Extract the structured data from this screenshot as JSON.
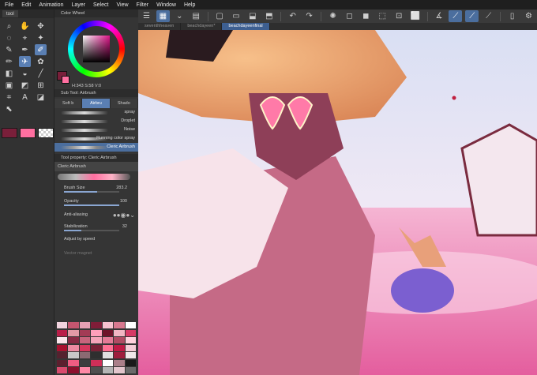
{
  "menu": [
    "File",
    "Edit",
    "Animation",
    "Layer",
    "Select",
    "View",
    "Filter",
    "Window",
    "Help"
  ],
  "tool_panel": {
    "tab_label": "tool"
  },
  "tools": [
    {
      "icon": "magnifier-icon",
      "glyph": "⌕"
    },
    {
      "icon": "hand-icon",
      "glyph": "✋"
    },
    {
      "icon": "move-icon",
      "glyph": "✥"
    },
    {
      "icon": "lasso-icon",
      "glyph": "◌"
    },
    {
      "icon": "select-icon",
      "glyph": "⌖"
    },
    {
      "icon": "wand-icon",
      "glyph": "✦"
    },
    {
      "icon": "eyedropper-icon",
      "glyph": "✎"
    },
    {
      "icon": "pen-icon",
      "glyph": "✒"
    },
    {
      "icon": "brush-icon",
      "glyph": "✐",
      "active": true
    },
    {
      "icon": "pencil-icon",
      "glyph": "✏"
    },
    {
      "icon": "airbrush-icon",
      "glyph": "✈",
      "active": true
    },
    {
      "icon": "decoration-icon",
      "glyph": "✿"
    },
    {
      "icon": "eraser-icon",
      "glyph": "◧"
    },
    {
      "icon": "blend-icon",
      "glyph": "◒"
    },
    {
      "icon": "line-icon",
      "glyph": "╱"
    },
    {
      "icon": "fill-icon",
      "glyph": "▣"
    },
    {
      "icon": "gradient-icon",
      "glyph": "◩"
    },
    {
      "icon": "ruler-icon",
      "glyph": "⊞"
    },
    {
      "icon": "frame-icon",
      "glyph": "⌗"
    },
    {
      "icon": "text-icon",
      "glyph": "A"
    },
    {
      "icon": "balloon-icon",
      "glyph": "◪"
    },
    {
      "icon": "operation-icon",
      "glyph": "⬉"
    }
  ],
  "swatch_colors": {
    "main": "#7a1f3a",
    "sub": "#ff6fa0"
  },
  "color_wheel": {
    "title": "Color Wheel",
    "hsv_readout": "H:343  S:58  V:0"
  },
  "sub_tool": {
    "title": "Sub Tool: Airbrush",
    "tabs": [
      "Soft b",
      "Airbru",
      "Shado"
    ],
    "brushes": [
      {
        "label": "spray",
        "active": false
      },
      {
        "label": "Droplet",
        "active": false
      },
      {
        "label": "Noise",
        "active": false
      },
      {
        "label": "Running color spray",
        "active": false
      },
      {
        "label": "Cleric Airbrush",
        "active": true
      }
    ]
  },
  "tool_property": {
    "title": "Tool property: Cleric Airbrush",
    "brush_name": "Cleric Airbrush",
    "brush_size": {
      "label": "Brush Size",
      "value": "283.2"
    },
    "opacity": {
      "label": "Opacity",
      "value": "100"
    },
    "anti_aliasing": {
      "label": "Anti-aliasing"
    },
    "stabilization": {
      "label": "Stabilization",
      "value": "32"
    },
    "adjust_by_speed": "Adjust by speed",
    "vector_magnet": "Vector magnet"
  },
  "tabs": [
    {
      "label": "seventhheaven",
      "active": false
    },
    {
      "label": "beachdayeen*",
      "active": false
    },
    {
      "label": "beachdayeenfinal",
      "active": true
    }
  ],
  "palette": [
    "#f2d4df",
    "#c4566f",
    "#e7a0b4",
    "#801d38",
    "#f7c3d0",
    "#d7798f",
    "#ffffff",
    "#b91e49",
    "#e29aa6",
    "#a33b55",
    "#ff9fba",
    "#6f1329",
    "#f1b5c2",
    "#d63a66",
    "#fbe6ec",
    "#892a44",
    "#c7647c",
    "#f5a3b8",
    "#e47a96",
    "#b04b63",
    "#ffd1dc",
    "#a8112f",
    "#ee8aa2",
    "#d6375d",
    "#7a2035",
    "#ff6f93",
    "#c01a45",
    "#f4ccd6",
    "#54222f",
    "#c8c8c8",
    "#8b6a72",
    "#2f2f2f",
    "#e0e0e0",
    "#9e1d3d",
    "#f0e8ea",
    "#5c1f2e",
    "#ef5c83",
    "#3d3d3d",
    "#cf2f58",
    "#ffffff",
    "#aa7f89",
    "#1a1a1a",
    "#d84a6d",
    "#8c0f2d",
    "#ff89a6",
    "#4f4f4f",
    "#b5b5b5",
    "#e3c5cc",
    "#6a6a6a"
  ],
  "colors": {
    "accent": "#5a7fb3",
    "tab_active": "#3d5f91"
  }
}
